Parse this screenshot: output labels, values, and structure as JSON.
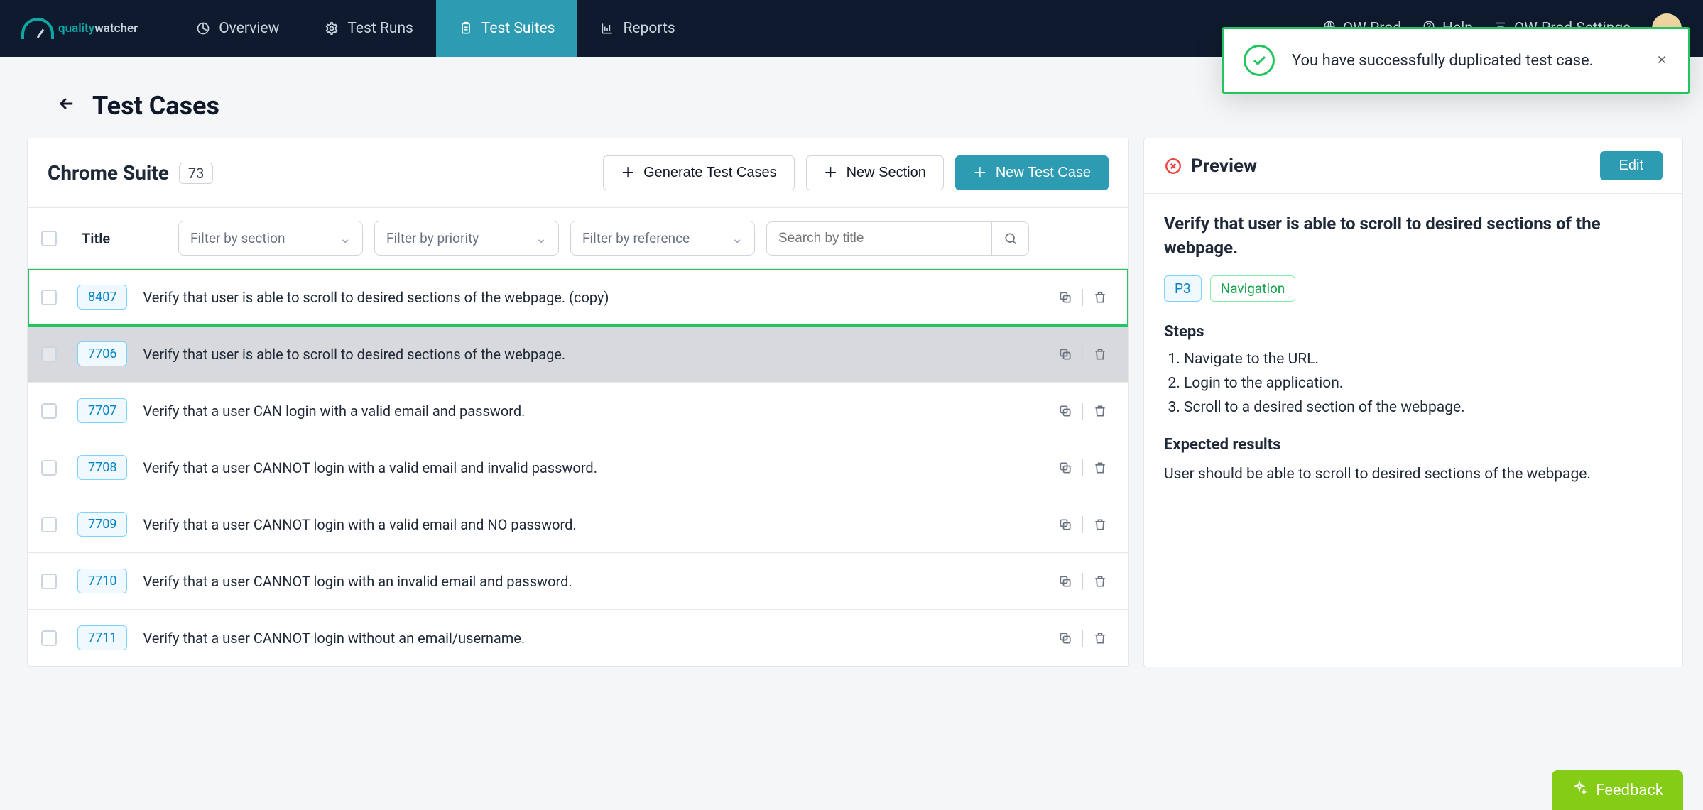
{
  "logo": {
    "brand_a": "quality",
    "brand_b": "watcher"
  },
  "nav": {
    "overview": "Overview",
    "test_runs": "Test Runs",
    "test_suites": "Test Suites",
    "reports": "Reports"
  },
  "nav_right": {
    "workspace": "QW Prod",
    "help": "Help",
    "settings": "QW Prod Settings"
  },
  "toast": {
    "text": "You have successfully duplicated test case."
  },
  "page": {
    "title": "Test Cases"
  },
  "suite": {
    "title": "Chrome Suite",
    "count": "73",
    "generate": "Generate Test Cases",
    "new_section": "New Section",
    "new_test_case": "New Test Case"
  },
  "filters": {
    "title_label": "Title",
    "section_placeholder": "Filter by section",
    "priority_placeholder": "Filter by priority",
    "reference_placeholder": "Filter by reference",
    "search_placeholder": "Search by title"
  },
  "rows": [
    {
      "id": "8407",
      "title": "Verify that user is able to scroll to desired sections of the webpage. (copy)",
      "highlight": true
    },
    {
      "id": "7706",
      "title": "Verify that user is able to scroll to desired sections of the webpage.",
      "selected": true
    },
    {
      "id": "7707",
      "title": "Verify that a user CAN login with a valid email and password."
    },
    {
      "id": "7708",
      "title": "Verify that a user CANNOT login with a valid email and invalid password."
    },
    {
      "id": "7709",
      "title": "Verify that a user CANNOT login with a valid email and NO password."
    },
    {
      "id": "7710",
      "title": "Verify that a user CANNOT login with an invalid email and password."
    },
    {
      "id": "7711",
      "title": "Verify that a user CANNOT login without an email/username."
    }
  ],
  "preview": {
    "header": "Preview",
    "edit": "Edit",
    "title": "Verify that user is able to scroll to desired sections of the webpage.",
    "priority": "P3",
    "category": "Navigation",
    "steps_label": "Steps",
    "steps": [
      "Navigate to the URL.",
      "Login to the application.",
      "Scroll to a desired section of the webpage."
    ],
    "expected_label": "Expected results",
    "expected": "User should be able to scroll to desired sections of the webpage."
  },
  "feedback": "Feedback"
}
